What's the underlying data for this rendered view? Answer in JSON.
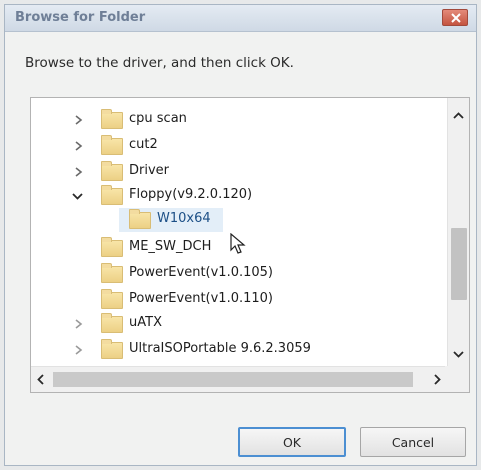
{
  "window": {
    "title": "Browse for Folder"
  },
  "instruction": "Browse to the driver, and then click OK.",
  "tree": {
    "items": [
      {
        "label": "cpu scan",
        "expanded": false,
        "has_chevron": true
      },
      {
        "label": "cut2",
        "expanded": false,
        "has_chevron": true
      },
      {
        "label": "Driver",
        "expanded": false,
        "has_chevron": true
      },
      {
        "label": "Floppy(v9.2.0.120)",
        "expanded": true,
        "has_chevron": true
      },
      {
        "label": "W10x64",
        "selected": true,
        "child": true
      },
      {
        "label": "ME_SW_DCH",
        "has_chevron": false
      },
      {
        "label": "PowerEvent(v1.0.105)",
        "has_chevron": false
      },
      {
        "label": "PowerEvent(v1.0.110)",
        "has_chevron": false
      },
      {
        "label": "uATX",
        "expanded": false,
        "has_chevron": true
      },
      {
        "label": "UltraISOPortable 9.6.2.3059",
        "expanded": false,
        "has_chevron": true
      }
    ]
  },
  "buttons": {
    "ok": "OK",
    "cancel": "Cancel"
  },
  "colors": {
    "selection": "#e3eef8",
    "focus_border": "#4c8fd2",
    "folder": "#ecd085"
  }
}
